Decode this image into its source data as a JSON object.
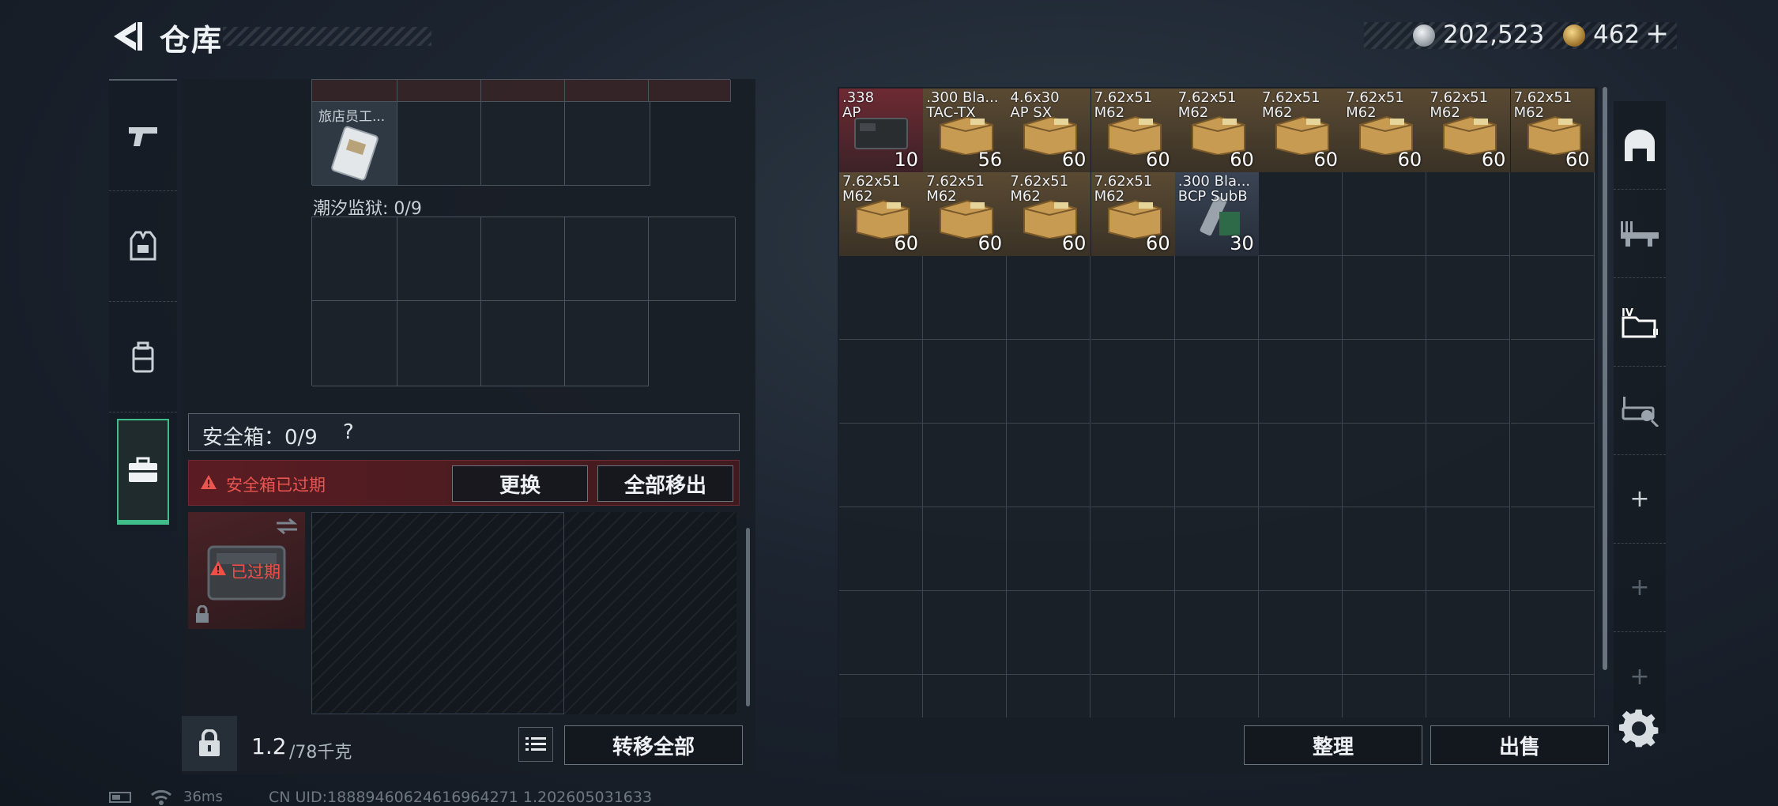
{
  "header": {
    "title": "仓库"
  },
  "currency": {
    "silver": "202,523",
    "gold": "462",
    "plus": "+"
  },
  "left_nav": {
    "tabs": [
      {
        "icon": "pistol-icon"
      },
      {
        "icon": "armor-vest-icon"
      },
      {
        "icon": "backpack-icon"
      },
      {
        "icon": "briefcase-icon",
        "active": true
      }
    ]
  },
  "containers": {
    "hotel_item_name": "旅店员工...",
    "travel_label": "潮汐监狱: 0/9"
  },
  "safe_box": {
    "label": "安全箱：0/9",
    "help": "?",
    "expired_banner": "安全箱已过期",
    "replace_label": "更换",
    "move_all_out_label": "全部移出",
    "thumb_expired": "已过期"
  },
  "weight": {
    "current": "1.2",
    "max": "/78千克"
  },
  "left_buttons": {
    "transfer_all_label": "转移全部"
  },
  "stash": {
    "items": [
      {
        "name": ".338\nAP",
        "count": "10",
        "color": "red"
      },
      {
        "name": ".300 Bla...\nTAC-TX",
        "count": "56",
        "color": "tan"
      },
      {
        "name": "4.6x30\nAP SX",
        "count": "60",
        "color": "tan"
      },
      {
        "name": "7.62x51\nM62",
        "count": "60",
        "color": "tan"
      },
      {
        "name": "7.62x51\nM62",
        "count": "60",
        "color": "tan"
      },
      {
        "name": "7.62x51\nM62",
        "count": "60",
        "color": "tan"
      },
      {
        "name": "7.62x51\nM62",
        "count": "60",
        "color": "tan"
      },
      {
        "name": "7.62x51\nM62",
        "count": "60",
        "color": "tan"
      },
      {
        "name": "7.62x51\nM62",
        "count": "60",
        "color": "tan"
      },
      {
        "name": "7.62x51\nM62",
        "count": "60",
        "color": "tan"
      },
      {
        "name": "7.62x51\nM62",
        "count": "60",
        "color": "tan"
      },
      {
        "name": "7.62x51\nM62",
        "count": "60",
        "color": "tan"
      },
      {
        "name": "7.62x51\nM62",
        "count": "60",
        "color": "tan"
      },
      {
        "name": ".300 Bla...\nBCP SubB",
        "count": "30",
        "color": "blue"
      }
    ],
    "tidy_label": "整理",
    "sell_label": "出售"
  },
  "right_nav": {
    "tabs": [
      {
        "icon": "stash-arch-icon"
      },
      {
        "icon": "weapon-rack-icon"
      },
      {
        "icon": "storage-folder-icon",
        "active": true
      },
      {
        "icon": "workshop-icon"
      }
    ],
    "plus": "+"
  },
  "status_bar": {
    "ping": "36ms",
    "uid": "CN UID:18889460624616964271 1.202605031633"
  },
  "colors": {
    "accent_green": "#3fbd8a",
    "alert_red": "#e8564f",
    "ammo_tan": "#c89b52"
  }
}
